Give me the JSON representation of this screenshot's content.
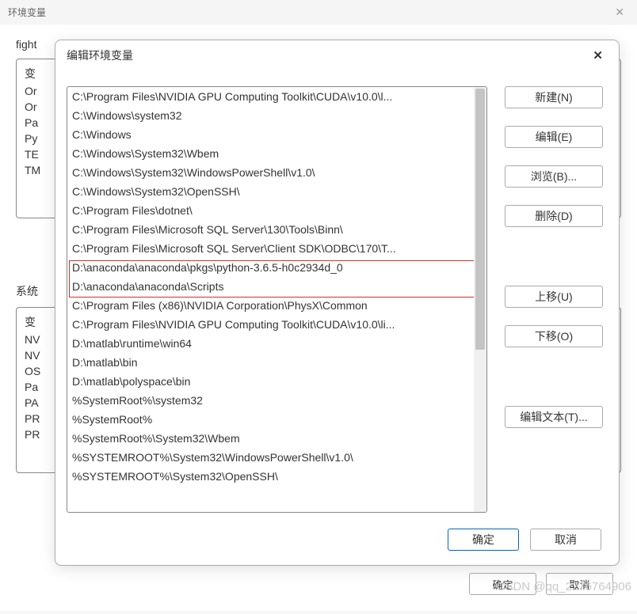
{
  "parent_dialog": {
    "title": "环境变量",
    "user_vars_label": "fight",
    "user_vars_header": "变",
    "user_vars_rows": [
      "Or",
      "Or",
      "Pa",
      "Py",
      "TE",
      "TM"
    ],
    "system_vars_label": "系统",
    "system_vars_header": "变",
    "system_vars_rows": [
      "NV",
      "NV",
      "OS",
      "Pa",
      "PA",
      "PR",
      "PR"
    ],
    "ok_label": "确定",
    "cancel_label": "取消"
  },
  "edit_dialog": {
    "title": "编辑环境变量",
    "entries": [
      "C:\\Program Files\\NVIDIA GPU Computing Toolkit\\CUDA\\v10.0\\l...",
      "C:\\Windows\\system32",
      "C:\\Windows",
      "C:\\Windows\\System32\\Wbem",
      "C:\\Windows\\System32\\WindowsPowerShell\\v1.0\\",
      "C:\\Windows\\System32\\OpenSSH\\",
      "C:\\Program Files\\dotnet\\",
      "C:\\Program Files\\Microsoft SQL Server\\130\\Tools\\Binn\\",
      "C:\\Program Files\\Microsoft SQL Server\\Client SDK\\ODBC\\170\\T...",
      "D:\\anaconda\\anaconda\\pkgs\\python-3.6.5-h0c2934d_0",
      "D:\\anaconda\\anaconda\\Scripts",
      "C:\\Program Files (x86)\\NVIDIA Corporation\\PhysX\\Common",
      "C:\\Program Files\\NVIDIA GPU Computing Toolkit\\CUDA\\v10.0\\li...",
      "D:\\matlab\\runtime\\win64",
      "D:\\matlab\\bin",
      "D:\\matlab\\polyspace\\bin",
      "%SystemRoot%\\system32",
      "%SystemRoot%",
      "%SystemRoot%\\System32\\Wbem",
      "%SYSTEMROOT%\\System32\\WindowsPowerShell\\v1.0\\",
      "%SYSTEMROOT%\\System32\\OpenSSH\\"
    ],
    "buttons": {
      "new": "新建(N)",
      "edit": "编辑(E)",
      "browse": "浏览(B)...",
      "delete": "删除(D)",
      "move_up": "上移(U)",
      "move_down": "下移(O)",
      "edit_text": "编辑文本(T)..."
    },
    "ok_label": "确定",
    "cancel_label": "取消"
  },
  "watermark": "CSDN @qq_2276764906"
}
